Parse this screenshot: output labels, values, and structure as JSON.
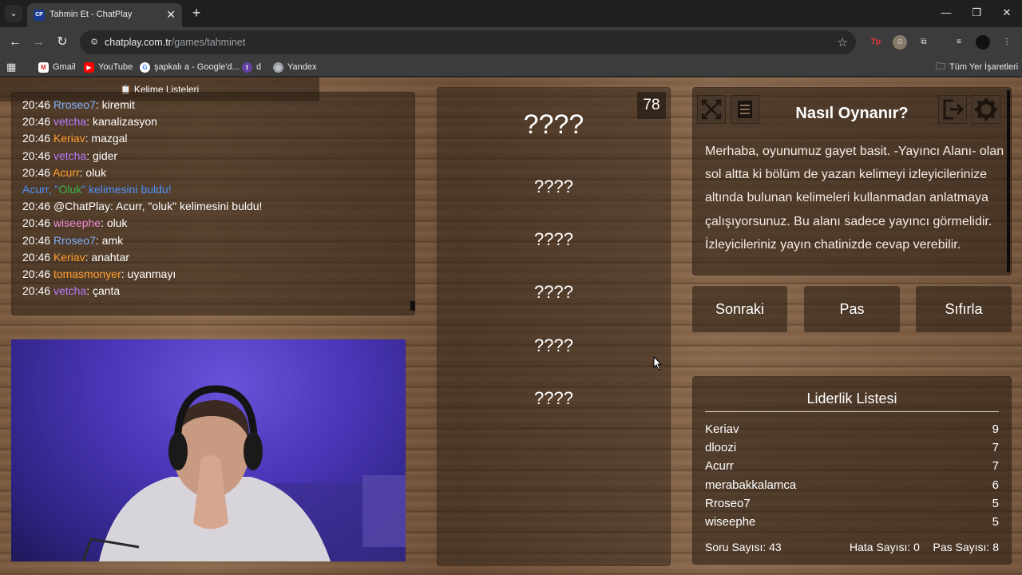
{
  "browser": {
    "tab_title": "Tahmin Et - ChatPlay",
    "tab_favicon": "CP",
    "url_host": "chatplay.com.tr",
    "url_path": "/games/tahminet",
    "bookmarks": [
      "Gmail",
      "YouTube",
      "şapkalı a - Google'd...",
      "d",
      "Yandex"
    ],
    "all_bookmarks": "Tüm Yer İşaretleri"
  },
  "chat": {
    "lines": [
      {
        "time": "20:46",
        "user": "Rroseo7",
        "color": "#7fb3ff",
        "msg": ": kiremit"
      },
      {
        "time": "20:46",
        "user": "vetcha",
        "color": "#b77bff",
        "msg": ": kanalizasyon"
      },
      {
        "time": "20:46",
        "user": "Keriav",
        "color": "#ff9f2e",
        "msg": ": mazgal"
      },
      {
        "time": "20:46",
        "user": "vetcha",
        "color": "#b77bff",
        "msg": ": gider"
      },
      {
        "time": "20:46",
        "user": "Acurr",
        "color": "#ff9f2e",
        "msg": ": oluk"
      },
      {
        "system": true,
        "pre": "Acurr, \"",
        "hl": "Oluk",
        "post": "\" kelimesini buldu!"
      },
      {
        "time": "20:46",
        "user": "@ChatPlay",
        "color": "#ffffff",
        "msg": ": Acurr, \"oluk\" kelimesini buldu!"
      },
      {
        "time": "20:46",
        "user": "wiseephe",
        "color": "#f08ad9",
        "msg": ": oluk"
      },
      {
        "time": "20:46",
        "user": "Rroseo7",
        "color": "#7fb3ff",
        "msg": ": amk"
      },
      {
        "time": "20:46",
        "user": "Keriav",
        "color": "#ff9f2e",
        "msg": ": anahtar"
      },
      {
        "time": "20:46",
        "user": "tomasmonyer",
        "color": "#ff9f2e",
        "msg": ": uyanmayı"
      },
      {
        "time": "20:46",
        "user": "vetcha",
        "color": "#b77bff",
        "msg": ": çanta"
      }
    ]
  },
  "game": {
    "timer": "78",
    "words": [
      "????",
      "????",
      "????",
      "????",
      "????",
      "????"
    ]
  },
  "howto": {
    "title": "Nasıl Oynanır?",
    "text": "Merhaba, oyunumuz gayet basit. -Yayıncı Alanı- olan sol altta ki bölüm de yazan kelimeyi izleyicilerinize altında bulunan kelimeleri kullanmadan anlatmaya çalışıyorsunuz. Bu alanı sadece yayıncı görmelidir. İzleyicileriniz yayın chatinizde cevap verebilir."
  },
  "actions": {
    "next": "Sonraki",
    "pass": "Pas",
    "reset": "Sıfırla",
    "word_lists": "Kelime Listeleri"
  },
  "leaderboard": {
    "title": "Liderlik Listesi",
    "rows": [
      {
        "name": "Keriav",
        "score": "9"
      },
      {
        "name": "dloozi",
        "score": "7"
      },
      {
        "name": "Acurr",
        "score": "7"
      },
      {
        "name": "merabakkalamca",
        "score": "6"
      },
      {
        "name": "Rroseo7",
        "score": "5"
      },
      {
        "name": "wiseephe",
        "score": "5"
      }
    ],
    "questions": "Soru Sayısı: 43",
    "errors": "Hata Sayısı: 0",
    "passes": "Pas Sayısı: 8"
  }
}
